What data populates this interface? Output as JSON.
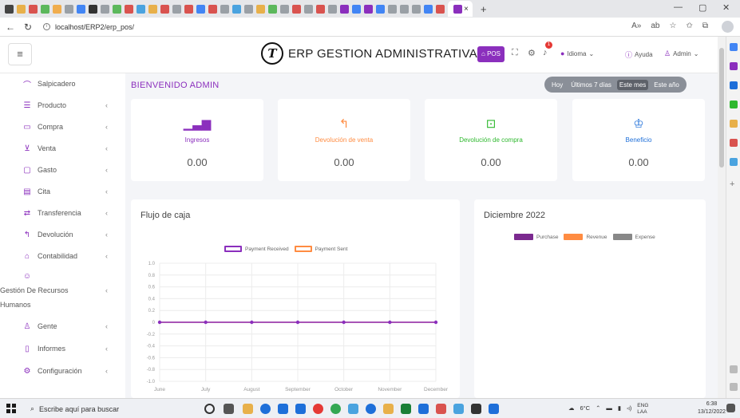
{
  "browser": {
    "active_tab_close": "×",
    "new_tab": "+",
    "url": "localhost/ERP2/erp_pos/",
    "window_controls": {
      "minimize": "—",
      "maximize": "▢",
      "close": "✕"
    }
  },
  "header": {
    "title": "ERP GESTION ADMINISTRATIVA",
    "logo_letter": "T",
    "pos_label": "POS",
    "notification_count": "1",
    "language_label": "Idioma",
    "help_label": "Ayuda",
    "user_label": "Admin"
  },
  "sidebar": {
    "items": [
      {
        "label": "Salpicadero",
        "icon": "dashboard-icon"
      },
      {
        "label": "Producto",
        "icon": "product-icon"
      },
      {
        "label": "Compra",
        "icon": "purchase-icon"
      },
      {
        "label": "Venta",
        "icon": "cart-icon"
      },
      {
        "label": "Gasto",
        "icon": "wallet-icon"
      },
      {
        "label": "Cita",
        "icon": "calendar-icon"
      },
      {
        "label": "Transferencia",
        "icon": "transfer-icon"
      },
      {
        "label": "Devolución",
        "icon": "return-icon"
      },
      {
        "label": "Contabilidad",
        "icon": "accounting-icon"
      },
      {
        "label_line1": "Gestión De Recursos",
        "label_line2": "Humanos",
        "icon": "users-icon"
      },
      {
        "label": "Gente",
        "icon": "person-icon"
      },
      {
        "label": "Informes",
        "icon": "report-icon"
      },
      {
        "label": "Configuración",
        "icon": "gear-icon"
      }
    ]
  },
  "main": {
    "welcome": "BIENVENIDO ADMIN",
    "ranges": [
      "Hoy",
      "Últimos 7 días",
      "Este mes",
      "Este año"
    ],
    "active_range": "Este mes",
    "cards": [
      {
        "label": "Ingresos",
        "value": "0.00",
        "color": "#8b2fbd",
        "icon": "bar-chart-icon"
      },
      {
        "label": "Devolución de venta",
        "value": "0.00",
        "color": "#ff8c42",
        "icon": "return-arrow-icon"
      },
      {
        "label": "Devolución de compra",
        "value": "0.00",
        "color": "#2eb82e",
        "icon": "box-return-icon"
      },
      {
        "label": "Beneficio",
        "value": "0.00",
        "color": "#1e6fd9",
        "icon": "trophy-icon"
      }
    ],
    "cash_flow": {
      "title": "Flujo de caja"
    },
    "december": {
      "title": "Diciembre 2022"
    }
  },
  "chart_data": [
    {
      "type": "line",
      "title": "Flujo de caja",
      "categories": [
        "June",
        "July",
        "August",
        "September",
        "October",
        "November",
        "December"
      ],
      "series": [
        {
          "name": "Payment Received",
          "values": [
            0,
            0,
            0,
            0,
            0,
            0,
            0
          ],
          "color": "#8b2fbd"
        },
        {
          "name": "Payment Sent",
          "values": [
            0,
            0,
            0,
            0,
            0,
            0,
            0
          ],
          "color": "#ff8c42"
        }
      ],
      "ylim": [
        -1.0,
        1.0
      ],
      "y_ticks": [
        "1.0",
        "0.8",
        "0.6",
        "0.4",
        "0.2",
        "0",
        "-0.2",
        "-0.4",
        "-0.6",
        "-0.8",
        "-1.0"
      ],
      "grid": true,
      "legend": "top-center"
    },
    {
      "type": "pie",
      "title": "Diciembre 2022",
      "series": [
        {
          "name": "Purchase",
          "values": [],
          "color": "#7b2a8f"
        },
        {
          "name": "Revenue",
          "values": [],
          "color": "#ff8c42"
        },
        {
          "name": "Expense",
          "values": [],
          "color": "#888888"
        }
      ],
      "legend": "top-center"
    }
  ],
  "taskbar": {
    "search_placeholder": "Escribe aquí para buscar",
    "weather": "6°C",
    "lang_top": "ENG",
    "lang_bottom": "LAA",
    "time": "6:38",
    "date": "13/12/2022"
  }
}
